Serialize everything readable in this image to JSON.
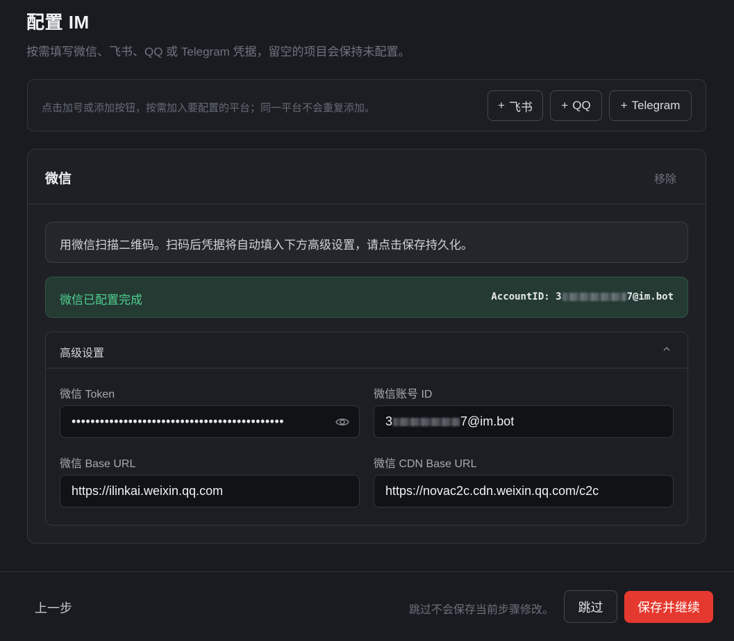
{
  "header": {
    "title": "配置 IM",
    "subtitle": "按需填写微信、飞书、QQ 或 Telegram 凭据，留空的项目会保持未配置。"
  },
  "add_platforms": {
    "hint": "点击加号或添加按钮，按需加入要配置的平台；同一平台不会重复添加。",
    "buttons": [
      {
        "plus": "+",
        "label": "飞书"
      },
      {
        "plus": "+",
        "label": "QQ"
      },
      {
        "plus": "+",
        "label": "Telegram"
      }
    ]
  },
  "wechat_card": {
    "title": "微信",
    "remove_label": "移除",
    "info_text": "用微信扫描二维码。扫码后凭据将自动填入下方高级设置，请点击保存持久化。",
    "status_text": "微信已配置完成",
    "account_label": "AccountID: ",
    "account_prefix": "3",
    "account_suffix": "7@im.bot",
    "advanced": {
      "title": "高级设置",
      "token_label": "微信 Token",
      "token_value": "•••••••••••••••••••••••••••••••••••••••••••••",
      "account_id_label": "微信账号 ID",
      "account_id_prefix": "3",
      "account_id_suffix": "7@im.bot",
      "base_url_label": "微信 Base URL",
      "base_url_value": "https://ilinkai.weixin.qq.com",
      "cdn_url_label": "微信 CDN Base URL",
      "cdn_url_value": "https://novac2c.cdn.weixin.qq.com/c2c"
    }
  },
  "footer": {
    "back_label": "上一步",
    "skip_hint": "跳过不会保存当前步骤修改。",
    "skip_label": "跳过",
    "save_label": "保存并继续"
  },
  "colors": {
    "background": "#1a1b20",
    "accent": "#e5382e",
    "success": "#4fcf8e"
  },
  "icons": [
    "eye-icon",
    "chevron-up-icon"
  ]
}
